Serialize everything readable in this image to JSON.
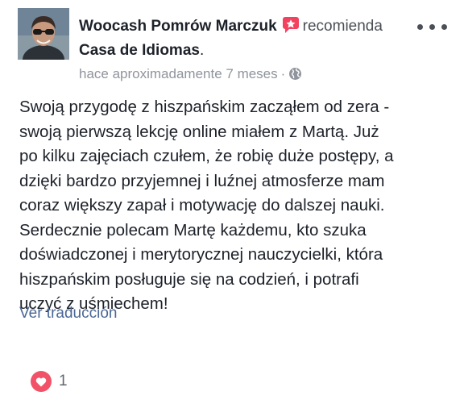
{
  "post": {
    "author": "Woocash Pomrów Marczuk",
    "action": "recomienda",
    "page": "Casa de Idiomas",
    "page_suffix": ".",
    "time": "hace aproximadamente 7 meses",
    "separator": "·",
    "icons": {
      "recommend": "recommend-star-icon",
      "audience": "globe-icon",
      "menu": "more-options-icon",
      "reaction": "heart-icon"
    },
    "body_lines": [
      "Swoją przygodę z hiszpańskim zacząłem od zera -",
      "swoją pierwszą lekcję online miałem z Martą. Już",
      "po kilku zajęciach czułem, że robię duże postępy, a",
      "dzięki bardzo przyjemnej i luźnej atmosferze mam",
      "coraz większy zapał i motywację do dalszej nauki.",
      "Serdecznie polecam Martę każdemu, kto szuka",
      "doświadczonej i merytorycznej nauczycielki, która",
      "hiszpańskim posługuje się na codzień, i potrafi",
      "uczyć z uśmiechem!"
    ],
    "translate_label": "Ver traducción",
    "reaction_count": "1"
  },
  "colors": {
    "text": "#1d2129",
    "meta": "#90949c",
    "link": "#4b6796",
    "recommend": "#f3425f",
    "heart": "#f25268"
  }
}
